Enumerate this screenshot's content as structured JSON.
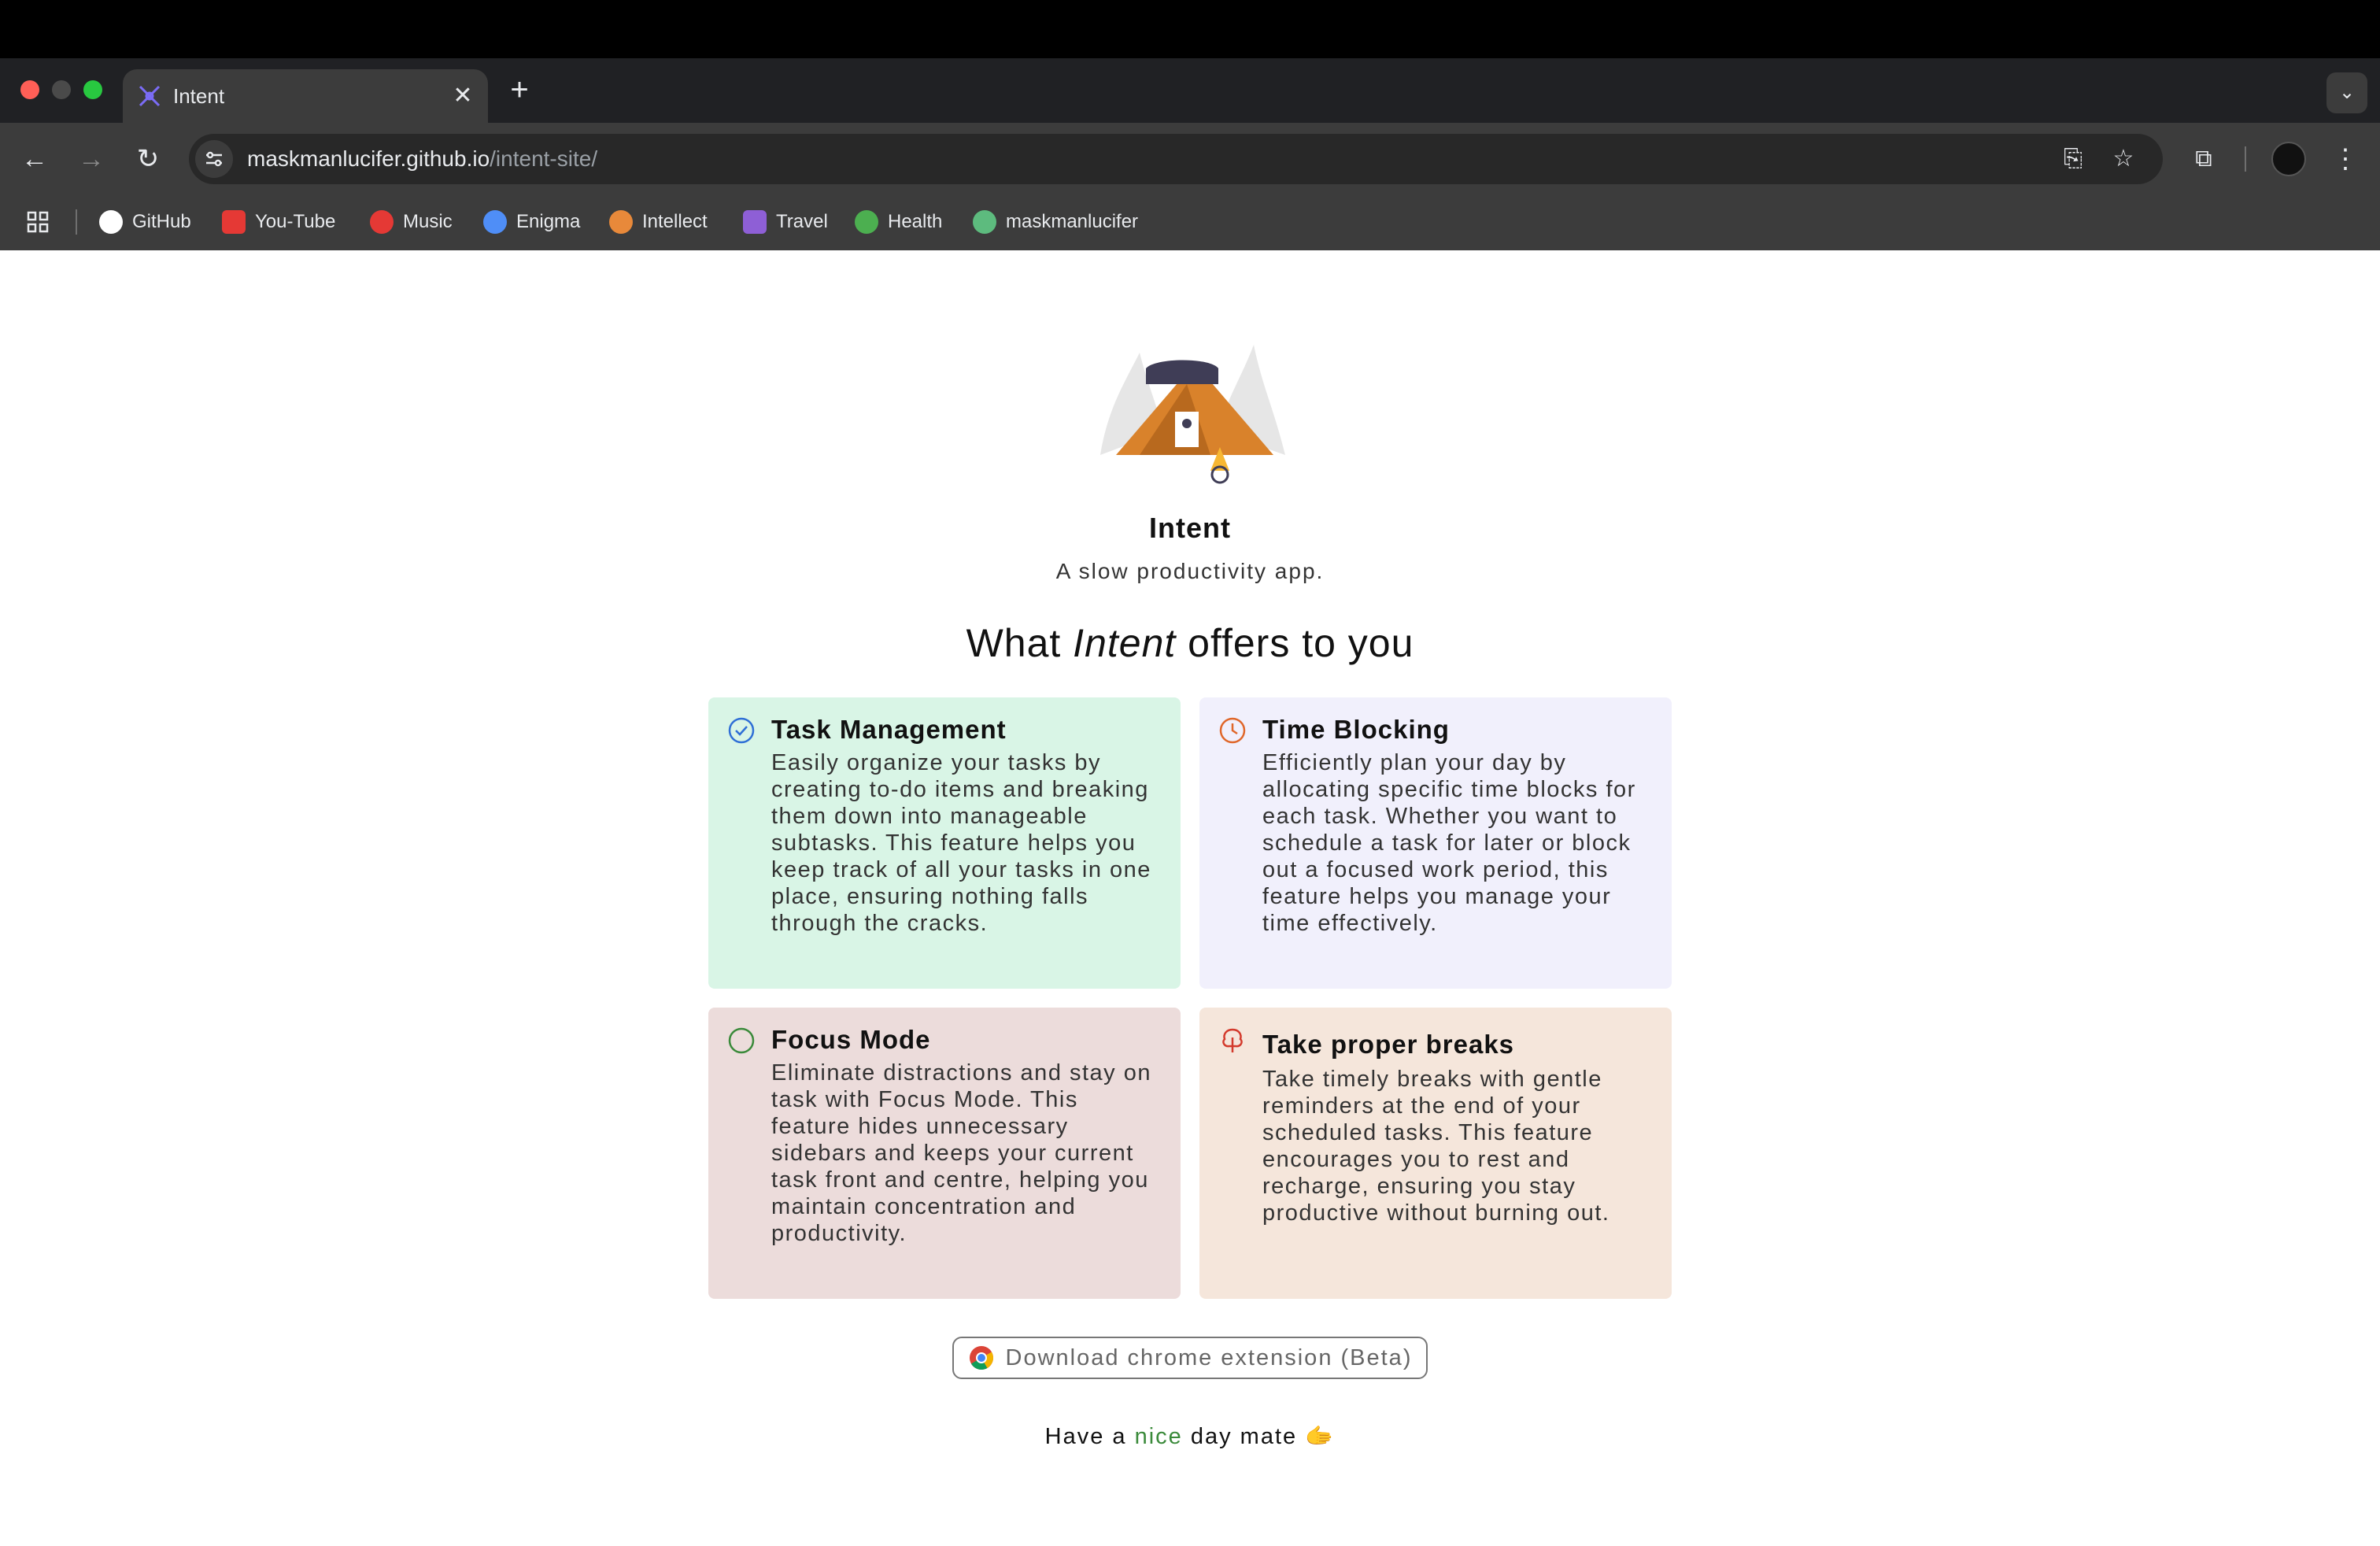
{
  "browser": {
    "tab_title": "Intent",
    "new_tab_symbol": "+",
    "url_host": "maskmanlucifer.github.io",
    "url_path": "/intent-site/",
    "bookmarks": [
      {
        "label": "GitHub",
        "icon": "github-icon",
        "color": "#ffffff"
      },
      {
        "label": "You-Tube",
        "icon": "youtube-icon",
        "color": "#e53935"
      },
      {
        "label": "Music",
        "icon": "music-icon",
        "color": "#e53935"
      },
      {
        "label": "Enigma",
        "icon": "enigma-icon",
        "color": "#4f8ef7"
      },
      {
        "label": "Intellect",
        "icon": "intellect-icon",
        "color": "#e8893a"
      },
      {
        "label": "Travel",
        "icon": "travel-icon",
        "color": "#8e5fd6"
      },
      {
        "label": "Health",
        "icon": "health-icon",
        "color": "#4caf50"
      },
      {
        "label": "maskmanlucifer",
        "icon": "profile-dot-icon",
        "color": "#5dbb7e"
      }
    ]
  },
  "page": {
    "app_title": "Intent",
    "tagline": "A slow productivity app.",
    "offers_prefix": "What ",
    "offers_emph": "Intent",
    "offers_suffix": " offers to you",
    "features": [
      {
        "title": "Task Management",
        "icon": "check-circle-icon",
        "bg": "#d9f5e6",
        "description": "Easily organize your tasks by creating to-do items and breaking them down into manageable subtasks. This feature helps you keep track of all your tasks in one place, ensuring nothing falls through the cracks."
      },
      {
        "title": "Time Blocking",
        "icon": "clock-icon",
        "bg": "#f1f0fc",
        "description": "Efficiently plan your day by allocating specific time blocks for each task. Whether you want to schedule a task for later or block out a focused work period, this feature helps you manage your time effectively."
      },
      {
        "title": "Focus Mode",
        "icon": "circle-icon",
        "bg": "#ecdcdb",
        "description": "Eliminate distractions and stay on task with Focus Mode. This feature hides unnecessary sidebars and keeps your current task front and centre, helping you maintain concentration and productivity."
      },
      {
        "title": "Take proper breaks",
        "icon": "tree-icon",
        "bg": "#f5e6db",
        "description": "Take timely breaks with gentle reminders at the end of your scheduled tasks. This feature encourages you to rest and recharge, ensuring you stay productive without burning out."
      }
    ],
    "download_label": "Download chrome extension (Beta)",
    "footer_prefix": "Have a ",
    "footer_nice": "nice",
    "footer_suffix": " day mate",
    "footer_emoji": "🫱"
  }
}
